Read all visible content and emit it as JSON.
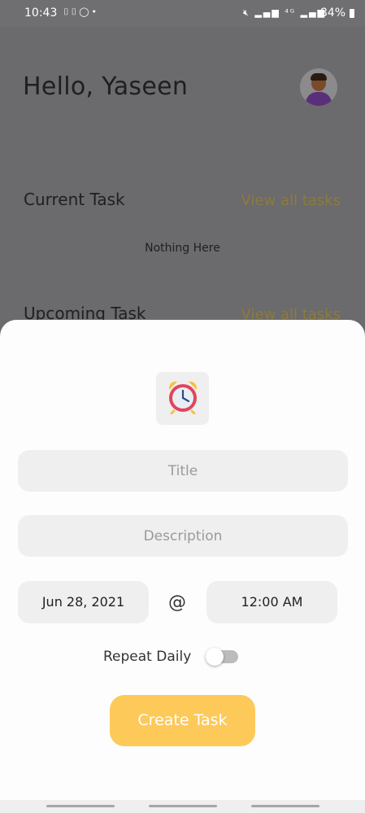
{
  "status_bar": {
    "time": "10:43",
    "battery": "84%",
    "left_icons": [
      "screenshot-icon",
      "screenshot-icon",
      "whatsapp-icon",
      "dot-icon"
    ],
    "right_icons": [
      "mute-icon",
      "signal-icon",
      "4g-icon",
      "signal-icon"
    ]
  },
  "home": {
    "greeting": "Hello, Yaseen",
    "current_section": {
      "title": "Current Task",
      "link": "View all tasks",
      "empty_text": "Nothing Here"
    },
    "upcoming_section": {
      "title": "Upcoming Task",
      "link": "View all tasks"
    }
  },
  "sheet": {
    "icon": "alarm-clock-icon",
    "title_placeholder": "Title",
    "description_placeholder": "Description",
    "date": "Jun 28, 2021",
    "at_symbol": "@",
    "time": "12:00 AM",
    "repeat_label": "Repeat Daily",
    "repeat_on": false,
    "create_button": "Create Task"
  },
  "colors": {
    "accent": "#fdc959",
    "field_bg": "#efefef",
    "overlay": "#6b6a6c"
  }
}
